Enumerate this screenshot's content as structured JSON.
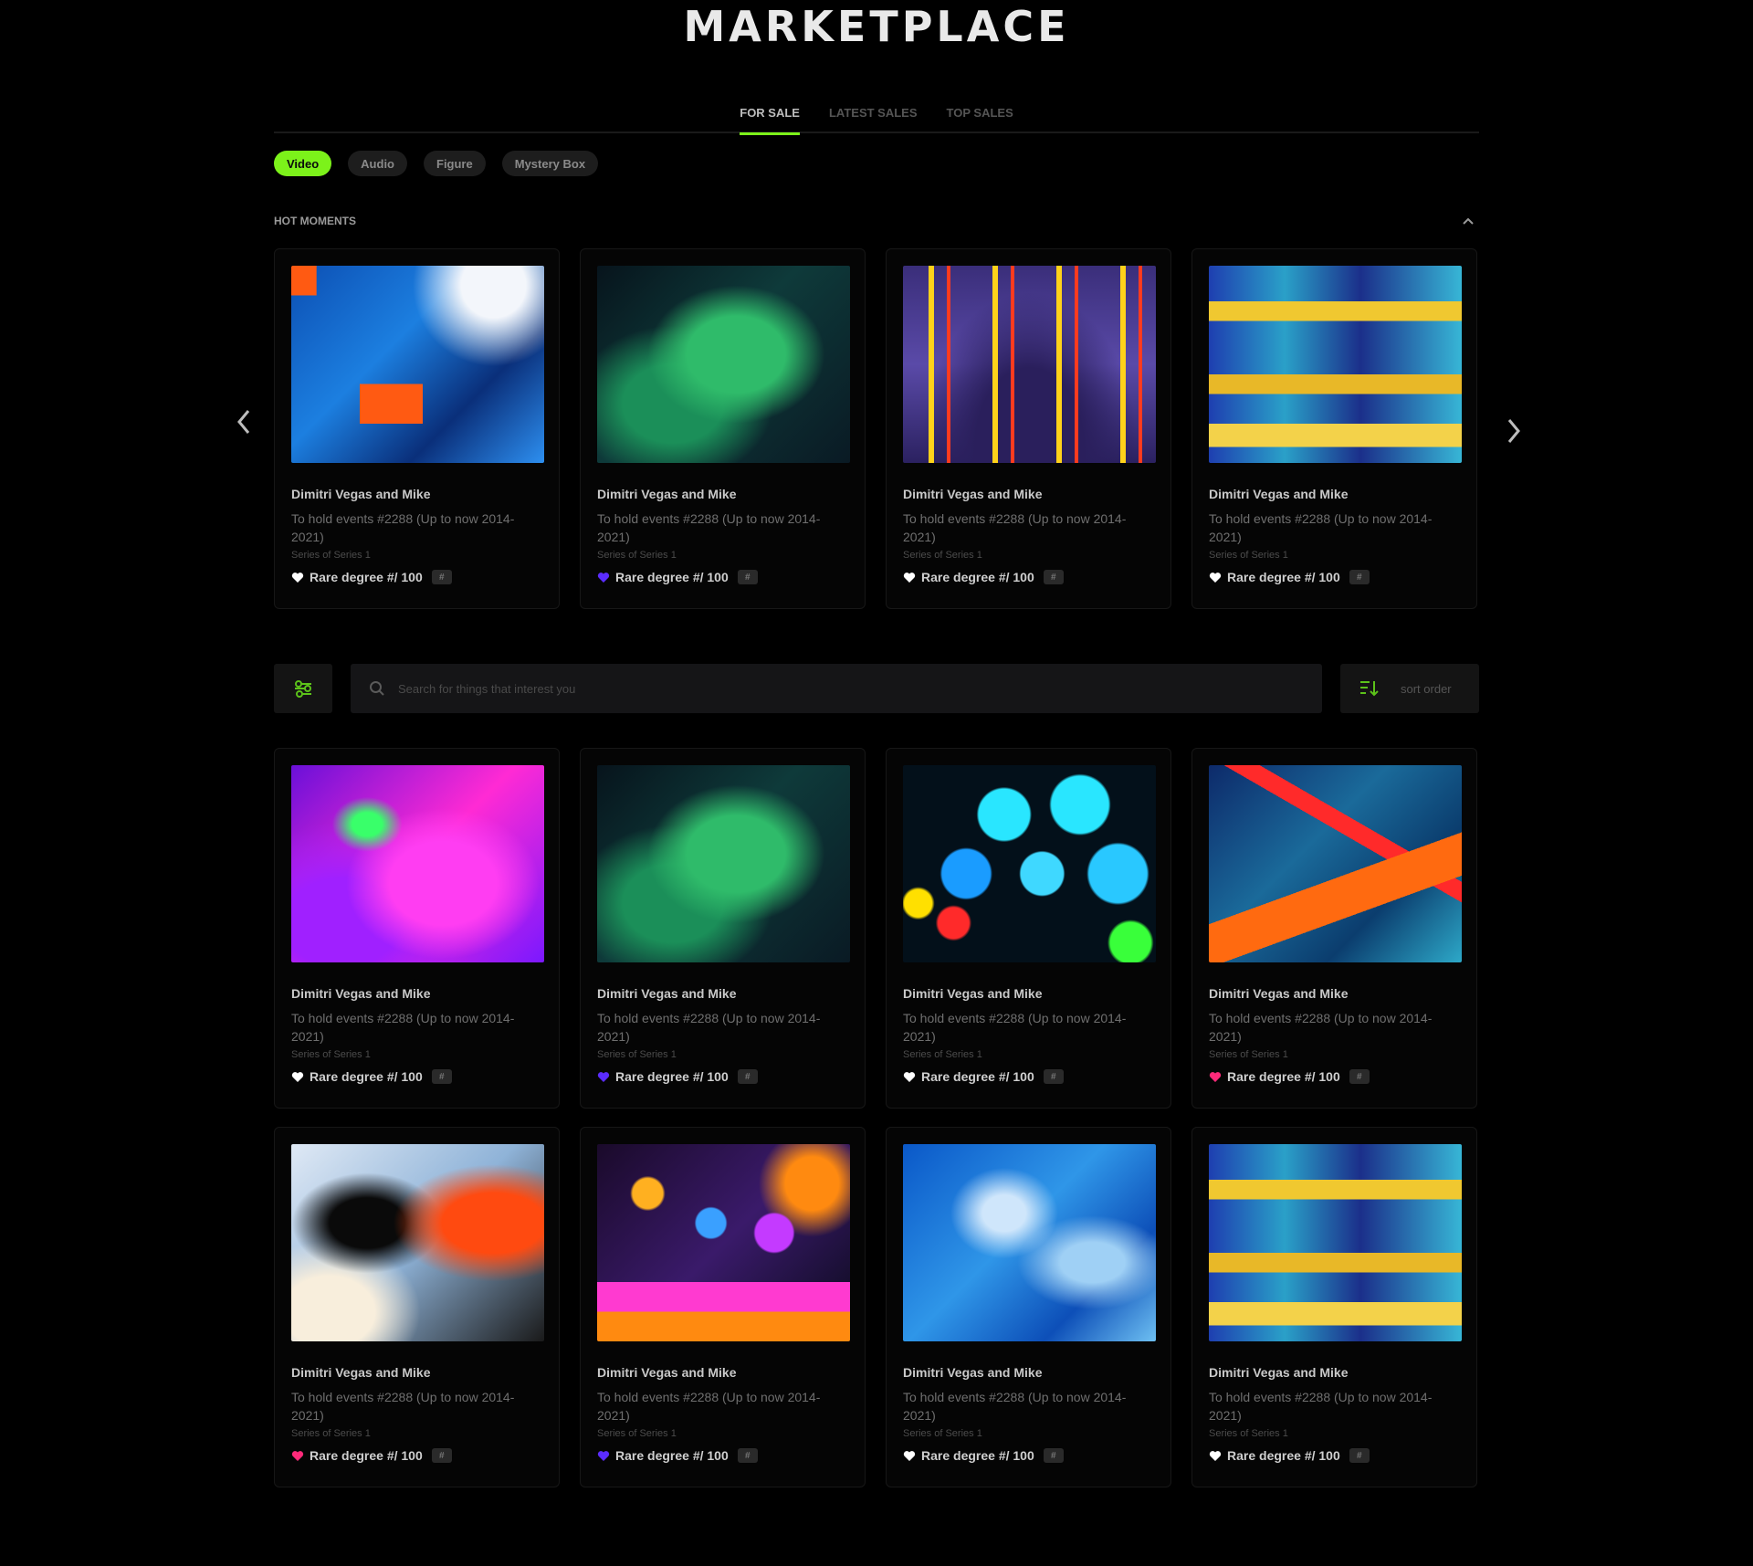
{
  "page": {
    "title": "MARKETPLACE"
  },
  "tabs": [
    {
      "label": "FOR SALE",
      "active": true
    },
    {
      "label": "LATEST SALES",
      "active": false
    },
    {
      "label": "TOP SALES",
      "active": false
    }
  ],
  "filters": [
    {
      "label": "Video",
      "active": true
    },
    {
      "label": "Audio",
      "active": false
    },
    {
      "label": "Figure",
      "active": false
    },
    {
      "label": "Mystery Box",
      "active": false
    }
  ],
  "hot_moments": {
    "title": "HOT MOMENTS",
    "cards": [
      {
        "name": "Dimitri Vegas and Mike",
        "desc": "To hold events #2288 (Up to now 2014-2021)",
        "series": "Series of Series 1",
        "rare": "Rare degree #/ 100",
        "badge": "#",
        "heart_color": "#ffffff"
      },
      {
        "name": "Dimitri Vegas and Mike",
        "desc": "To hold events #2288 (Up to now 2014-2021)",
        "series": "Series of Series 1",
        "rare": "Rare degree #/ 100",
        "badge": "#",
        "heart_color": "#5b2cff"
      },
      {
        "name": "Dimitri Vegas and Mike",
        "desc": "To hold events #2288 (Up to now 2014-2021)",
        "series": "Series of Series 1",
        "rare": "Rare degree #/ 100",
        "badge": "#",
        "heart_color": "#ffffff"
      },
      {
        "name": "Dimitri Vegas and Mike",
        "desc": "To hold events #2288 (Up to now 2014-2021)",
        "series": "Series of Series 1",
        "rare": "Rare degree #/ 100",
        "badge": "#",
        "heart_color": "#ffffff"
      }
    ]
  },
  "toolbar": {
    "search_placeholder": "Search for things that interest you",
    "sort_label": "sort order"
  },
  "grid": {
    "cards": [
      {
        "name": "Dimitri Vegas and Mike",
        "desc": "To hold events #2288 (Up to now 2014-2021)",
        "series": "Series of Series 1",
        "rare": "Rare degree #/ 100",
        "badge": "#",
        "heart_color": "#ffffff"
      },
      {
        "name": "Dimitri Vegas and Mike",
        "desc": "To hold events #2288 (Up to now 2014-2021)",
        "series": "Series of Series 1",
        "rare": "Rare degree #/ 100",
        "badge": "#",
        "heart_color": "#5b2cff"
      },
      {
        "name": "Dimitri Vegas and Mike",
        "desc": "To hold events #2288 (Up to now 2014-2021)",
        "series": "Series of Series 1",
        "rare": "Rare degree #/ 100",
        "badge": "#",
        "heart_color": "#ffffff"
      },
      {
        "name": "Dimitri Vegas and Mike",
        "desc": "To hold events #2288 (Up to now 2014-2021)",
        "series": "Series of Series 1",
        "rare": "Rare degree #/ 100",
        "badge": "#",
        "heart_color": "#ff2a7a"
      },
      {
        "name": "Dimitri Vegas and Mike",
        "desc": "To hold events #2288 (Up to now 2014-2021)",
        "series": "Series of Series 1",
        "rare": "Rare degree #/ 100",
        "badge": "#",
        "heart_color": "#ff2a7a"
      },
      {
        "name": "Dimitri Vegas and Mike",
        "desc": "To hold events #2288 (Up to now 2014-2021)",
        "series": "Series of Series 1",
        "rare": "Rare degree #/ 100",
        "badge": "#",
        "heart_color": "#5b2cff"
      },
      {
        "name": "Dimitri Vegas and Mike",
        "desc": "To hold events #2288 (Up to now 2014-2021)",
        "series": "Series of Series 1",
        "rare": "Rare degree #/ 100",
        "badge": "#",
        "heart_color": "#ffffff"
      },
      {
        "name": "Dimitri Vegas and Mike",
        "desc": "To hold events #2288 (Up to now 2014-2021)",
        "series": "Series of Series 1",
        "rare": "Rare degree #/ 100",
        "badge": "#",
        "heart_color": "#ffffff"
      }
    ]
  },
  "colors": {
    "accent": "#7cf21a",
    "background": "#000000",
    "card": "#050505"
  },
  "icons": {
    "prev": "chevron-left-icon",
    "next": "chevron-right-icon",
    "collapse": "chevron-up-icon",
    "filter": "filter-icon",
    "search": "search-icon",
    "sort": "sort-icon",
    "heart": "heart-icon"
  }
}
